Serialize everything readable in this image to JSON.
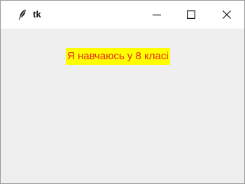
{
  "window": {
    "title": "tk",
    "app_icon": "feather-icon",
    "controls": {
      "minimize_icon": "minimize-icon",
      "maximize_icon": "maximize-icon",
      "close_icon": "close-icon"
    }
  },
  "content": {
    "label_text": "Я навчаюсь у 8 класі",
    "label_fg": "#e8241c",
    "label_bg": "#ffff00"
  }
}
